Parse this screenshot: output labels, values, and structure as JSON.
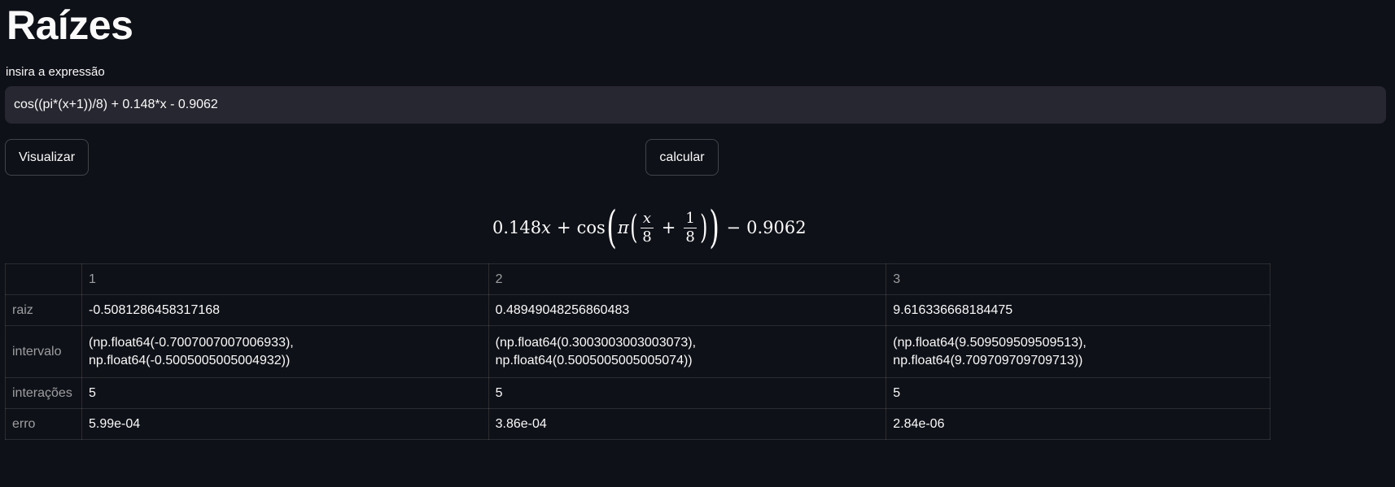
{
  "title": "Raízes",
  "expression_input": {
    "label": "insira a expressão",
    "value": "cos((pi*(x+1))/8) + 0.148*x - 0.9062"
  },
  "buttons": {
    "visualize": "Visualizar",
    "calculate": "calcular"
  },
  "formula": {
    "coef": "0.148",
    "var": "x",
    "plus": "+",
    "func": "cos",
    "pi": "π",
    "frac1_num": "x",
    "frac1_den": "8",
    "frac2_num": "1",
    "frac2_den": "8",
    "minus": "−",
    "const": "0.9062"
  },
  "table": {
    "columns": [
      "",
      "1",
      "2",
      "3"
    ],
    "rows": [
      {
        "label": "raiz",
        "cells": [
          "-0.5081286458317168",
          "0.48949048256860483",
          "9.616336668184475"
        ]
      },
      {
        "label": "intervalo",
        "cells": [
          [
            "(np.float64(-0.7007007007006933),",
            "np.float64(-0.5005005005004932))"
          ],
          [
            "(np.float64(0.3003003003003073),",
            "np.float64(0.5005005005005074))"
          ],
          [
            "(np.float64(9.509509509509513),",
            "np.float64(9.709709709709713))"
          ]
        ]
      },
      {
        "label": "interações",
        "cells": [
          "5",
          "5",
          "5"
        ]
      },
      {
        "label": "erro",
        "cells": [
          "5.99e-04",
          "3.86e-04",
          "2.84e-06"
        ]
      }
    ]
  }
}
